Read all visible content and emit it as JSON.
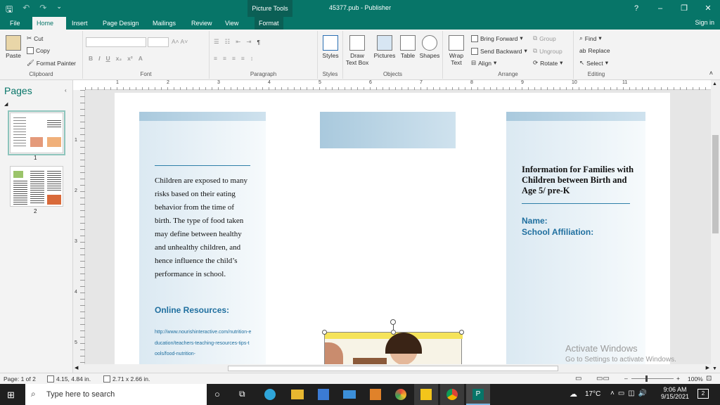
{
  "window": {
    "file_name": "45377.pub - Publisher",
    "context_tab_group": "Picture Tools",
    "help": "?",
    "minimize": "–",
    "restore": "❐",
    "close": "✕"
  },
  "tabs": [
    "File",
    "Home",
    "Insert",
    "Page Design",
    "Mailings",
    "Review",
    "View",
    "Format"
  ],
  "active_tab": "Home",
  "sign_in": "Sign in",
  "ribbon": {
    "clipboard": {
      "label": "Clipboard",
      "paste": "Paste",
      "cut": "Cut",
      "copy": "Copy",
      "format_painter": "Format Painter"
    },
    "font": {
      "label": "Font"
    },
    "paragraph": {
      "label": "Paragraph"
    },
    "styles": {
      "label": "Styles",
      "styles_btn": "Styles"
    },
    "objects": {
      "label": "Objects",
      "draw_text_box": "Draw Text Box",
      "pictures": "Pictures",
      "table": "Table",
      "shapes": "Shapes"
    },
    "arrange": {
      "label": "Arrange",
      "wrap_text": "Wrap Text",
      "bring_forward": "Bring Forward",
      "send_backward": "Send Backward",
      "align": "Align",
      "group": "Group",
      "ungroup": "Ungroup",
      "rotate": "Rotate"
    },
    "editing": {
      "label": "Editing",
      "find": "Find",
      "replace": "Replace",
      "select": "Select"
    }
  },
  "pages_pane": {
    "title": "Pages",
    "page1": "1",
    "page2": "2"
  },
  "ruler_numbers": [
    "1",
    "2",
    "3",
    "4",
    "5",
    "6",
    "7",
    "8",
    "9",
    "10",
    "11"
  ],
  "vruler_numbers": [
    "1",
    "2",
    "3",
    "4",
    "5"
  ],
  "document": {
    "left_panel_text": "Children are exposed to many risks based on their eating behavior from the time of birth. The type of food taken may define between healthy and unhealthy children, and hence influence the child’s performance in school.",
    "online_resources_heading": "Online Resources:",
    "resource_link": "http://www.nourishinteractive.com/nutrition-education/teachers-teaching-resources-tips-tools/food-nutrition-",
    "right_title": "Information for Families with Children between Birth and Age 5/ pre-K",
    "name_label": "Name:",
    "school_label": "School Affiliation:"
  },
  "watermark": {
    "line1": "Activate Windows",
    "line2": "Go to Settings to activate Windows."
  },
  "status": {
    "page": "Page: 1 of 2",
    "position": "4.15, 4.84 in.",
    "size": "2.71 x 2.66 in.",
    "zoom": "100%"
  },
  "taskbar": {
    "search_placeholder": "Type here to search",
    "temperature": "17°C",
    "time": "9:06 AM",
    "date": "9/15/2021",
    "notifications": "2"
  },
  "colors": {
    "accent": "#077568",
    "heading_blue": "#1f6f9f"
  }
}
